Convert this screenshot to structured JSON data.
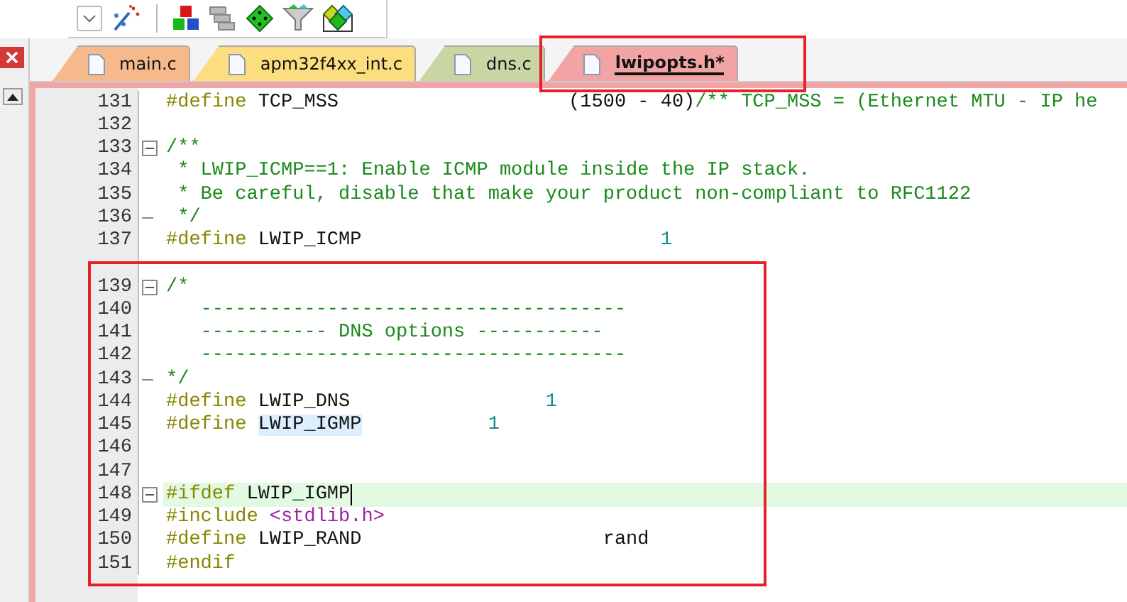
{
  "tabs": [
    {
      "label": "main.c",
      "color": "#f6b98c",
      "selected": false
    },
    {
      "label": "apm32f4xx_int.c",
      "color": "#fcdd80",
      "selected": false
    },
    {
      "label": "dns.c",
      "color": "#c9d6a3",
      "selected": false
    },
    {
      "label": "lwipopts.h*",
      "color": "#f2a4a4",
      "selected": true
    }
  ],
  "editor": {
    "lines": [
      {
        "number": "131",
        "collapsible": false,
        "block_end": false,
        "current": false,
        "tokens": [
          {
            "text": "#define ",
            "kind": "preproc"
          },
          {
            "text": "TCP_MSS                    (1500 - 40)",
            "kind": "ident"
          },
          {
            "text": "/** TCP_MSS = (Ethernet MTU - IP he",
            "kind": "comment"
          }
        ]
      },
      {
        "number": "132",
        "collapsible": false,
        "block_end": false,
        "current": false
      },
      {
        "number": "133",
        "collapsible": true,
        "block_end": false,
        "current": false,
        "tokens": [
          {
            "text": "/**",
            "kind": "comment"
          }
        ]
      },
      {
        "number": "134",
        "collapsible": false,
        "block_end": false,
        "current": false,
        "tokens": [
          {
            "text": " * LWIP_ICMP==1: Enable ICMP module inside the IP stack.",
            "kind": "comment"
          }
        ]
      },
      {
        "number": "135",
        "collapsible": false,
        "block_end": false,
        "current": false,
        "tokens": [
          {
            "text": " * Be careful, disable that make your product non-compliant to RFC1122",
            "kind": "comment"
          }
        ]
      },
      {
        "number": "136",
        "collapsible": false,
        "block_end": true,
        "current": false,
        "tokens": [
          {
            "text": " */",
            "kind": "comment"
          }
        ]
      },
      {
        "number": "137",
        "collapsible": false,
        "block_end": false,
        "current": false,
        "tokens": [
          {
            "text": "#define ",
            "kind": "preproc"
          },
          {
            "text": "LWIP_ICMP                          ",
            "kind": "ident"
          },
          {
            "text": "1",
            "kind": "number"
          }
        ]
      },
      {
        "collapsible": false,
        "block_end": false,
        "current": false
      },
      {
        "number": "139",
        "collapsible": true,
        "block_end": false,
        "current": false,
        "tokens": [
          {
            "text": "/*",
            "kind": "comment"
          }
        ]
      },
      {
        "number": "140",
        "collapsible": false,
        "block_end": false,
        "current": false,
        "tokens": [
          {
            "text": "   -------------------------------------",
            "kind": "comment"
          }
        ]
      },
      {
        "number": "141",
        "collapsible": false,
        "block_end": false,
        "current": false,
        "tokens": [
          {
            "text": "   ----------- DNS options -----------",
            "kind": "comment"
          }
        ]
      },
      {
        "number": "142",
        "collapsible": false,
        "block_end": false,
        "current": false,
        "tokens": [
          {
            "text": "   -------------------------------------",
            "kind": "comment"
          }
        ]
      },
      {
        "number": "143",
        "collapsible": false,
        "block_end": true,
        "current": false,
        "tokens": [
          {
            "text": "*/",
            "kind": "comment"
          }
        ]
      },
      {
        "number": "144",
        "collapsible": false,
        "block_end": false,
        "current": false,
        "tokens": [
          {
            "text": "#define ",
            "kind": "preproc"
          },
          {
            "text": "LWIP_DNS                 ",
            "kind": "ident"
          },
          {
            "text": "1",
            "kind": "number"
          }
        ]
      },
      {
        "number": "145",
        "collapsible": false,
        "block_end": false,
        "current": false,
        "tokens": [
          {
            "text": "#define ",
            "kind": "preproc"
          },
          {
            "text": "LWIP_IGMP",
            "kind": "match"
          },
          {
            "text": "           1",
            "kind": "number"
          }
        ]
      },
      {
        "number": "146",
        "collapsible": false,
        "block_end": false,
        "current": false
      },
      {
        "number": "147",
        "collapsible": false,
        "block_end": false,
        "current": false
      },
      {
        "number": "148",
        "collapsible": true,
        "block_end": false,
        "current": true,
        "tokens": [
          {
            "text": "#ifdef ",
            "kind": "preproc"
          },
          {
            "text": "LWIP_IGMP",
            "kind": "ident"
          }
        ]
      },
      {
        "number": "149",
        "collapsible": false,
        "block_end": false,
        "current": false,
        "tokens": [
          {
            "text": "#include ",
            "kind": "preproc"
          },
          {
            "text": "<stdlib.h>",
            "kind": "string"
          }
        ]
      },
      {
        "number": "150",
        "collapsible": false,
        "block_end": false,
        "current": false,
        "tokens": [
          {
            "text": "#define ",
            "kind": "preproc"
          },
          {
            "text": "LWIP_RAND                     rand",
            "kind": "ident"
          }
        ]
      },
      {
        "number": "151",
        "collapsible": false,
        "block_end": false,
        "current": false,
        "tokens": [
          {
            "text": "#endif",
            "kind": "preproc"
          }
        ]
      }
    ]
  }
}
